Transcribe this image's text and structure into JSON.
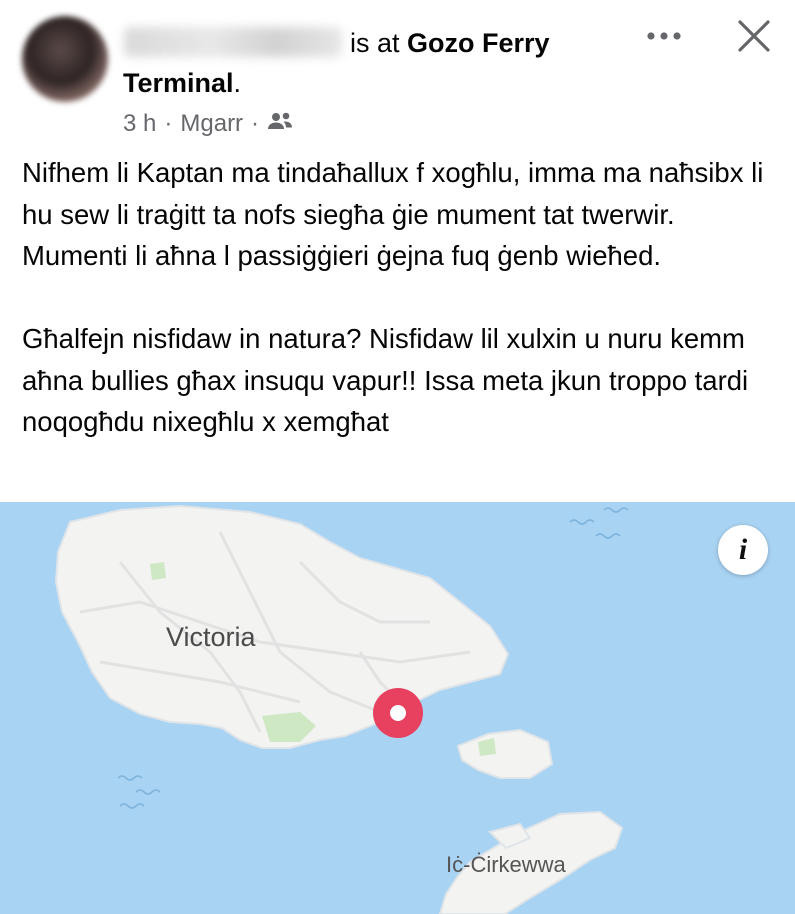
{
  "post": {
    "header": {
      "at_text": "is at",
      "place_name_part1": "Gozo Ferry",
      "place_name_part2": "Terminal",
      "period": ".",
      "time": "3 h",
      "separator": "·",
      "location": "Mgarr",
      "audience_icon": "friends-icon",
      "more_icon": "more-icon",
      "close_icon": "close-icon"
    },
    "paragraphs": [
      "Nifhem li Kaptan ma tindaħallux f xogħlu, imma ma naħsibx li hu sew li traġitt ta nofs siegħa ġie mument tat twerwir. Mumenti li aħna l passiġġieri ġejna fuq ġenb wieħed.",
      "Għalfejn nisfidaw in natura? Nisfidaw lil xulxin u nuru kemm aħna bullies għax insuqu vapur!! Issa meta jkun troppo tardi noqogħdu nixegħlu x xemgħat"
    ]
  },
  "map": {
    "labels": {
      "victoria": "Victoria",
      "cirkewwa": "Iċ-Ċirkewwa"
    },
    "info_button": "i",
    "colors": {
      "water": "#a9d3f3",
      "land": "#f3f3f1",
      "park": "#cfe8c4",
      "pin": "#e8405f"
    }
  }
}
